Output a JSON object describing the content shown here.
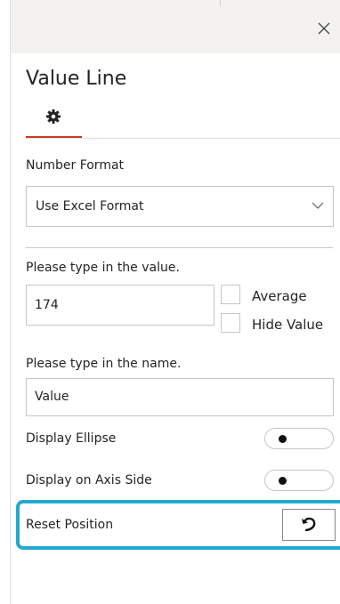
{
  "panel": {
    "title": "Value Line",
    "close_icon": "close-icon",
    "tab_icon": "gear-icon"
  },
  "number_format": {
    "label": "Number Format",
    "selected": "Use Excel Format",
    "chevron_icon": "chevron-down-icon"
  },
  "value_section": {
    "label": "Please type in the value.",
    "value": "174",
    "average_label": "Average",
    "average_checked": false,
    "hide_value_label": "Hide Value",
    "hide_value_checked": false
  },
  "name_section": {
    "label": "Please type in the name.",
    "value": "Value"
  },
  "toggles": {
    "display_ellipse_label": "Display Ellipse",
    "display_ellipse_on": false,
    "display_axis_side_label": "Display on Axis Side",
    "display_axis_side_on": false
  },
  "reset": {
    "label": "Reset Position",
    "icon": "undo-icon"
  },
  "colors": {
    "tab_accent": "#c43e1c",
    "highlight": "#23a9cf",
    "topbar": "#f3f2f1"
  }
}
